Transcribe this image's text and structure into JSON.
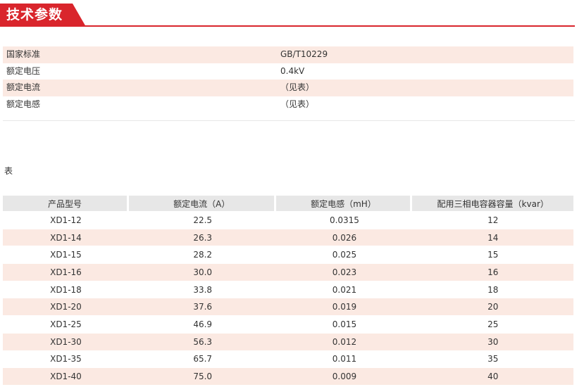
{
  "header": {
    "title": "技术参数"
  },
  "params": [
    {
      "label": "国家标准",
      "value": "GB/T10229"
    },
    {
      "label": "额定电压",
      "value": "0.4kV"
    },
    {
      "label": "额定电流",
      "value": "（见表）"
    },
    {
      "label": "额定电感",
      "value": "（见表）"
    }
  ],
  "table": {
    "caption": "表",
    "columns": [
      "产品型号",
      "额定电流（A）",
      "额定电感（mH）",
      "配用三相电容器容量（kvar）"
    ],
    "rows": [
      [
        "XD1-12",
        "22.5",
        "0.0315",
        "12"
      ],
      [
        "XD1-14",
        "26.3",
        "0.026",
        "14"
      ],
      [
        "XD1-15",
        "28.2",
        "0.025",
        "15"
      ],
      [
        "XD1-16",
        "30.0",
        "0.023",
        "16"
      ],
      [
        "XD1-18",
        "33.8",
        "0.021",
        "18"
      ],
      [
        "XD1-20",
        "37.6",
        "0.019",
        "20"
      ],
      [
        "XD1-25",
        "46.9",
        "0.015",
        "25"
      ],
      [
        "XD1-30",
        "56.3",
        "0.012",
        "30"
      ],
      [
        "XD1-35",
        "65.7",
        "0.011",
        "35"
      ],
      [
        "XD1-40",
        "75.0",
        "0.009",
        "40"
      ]
    ]
  },
  "colors": {
    "accent": "#d9252c",
    "stripe": "#fbe9e2",
    "table_header": "#e7e7e7"
  }
}
